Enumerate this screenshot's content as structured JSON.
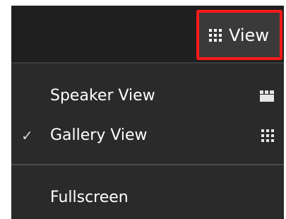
{
  "toolbar": {
    "view_button_label": "View",
    "view_button_icon": "grid-icon",
    "highlight_color": "#ff1a1a"
  },
  "menu": {
    "items": [
      {
        "label": "Speaker View",
        "checked": false,
        "icon": "speaker-view-icon"
      },
      {
        "label": "Gallery View",
        "checked": true,
        "check_mark": "✓",
        "icon": "gallery-view-icon"
      },
      {
        "label": "Fullscreen",
        "checked": false
      }
    ]
  }
}
